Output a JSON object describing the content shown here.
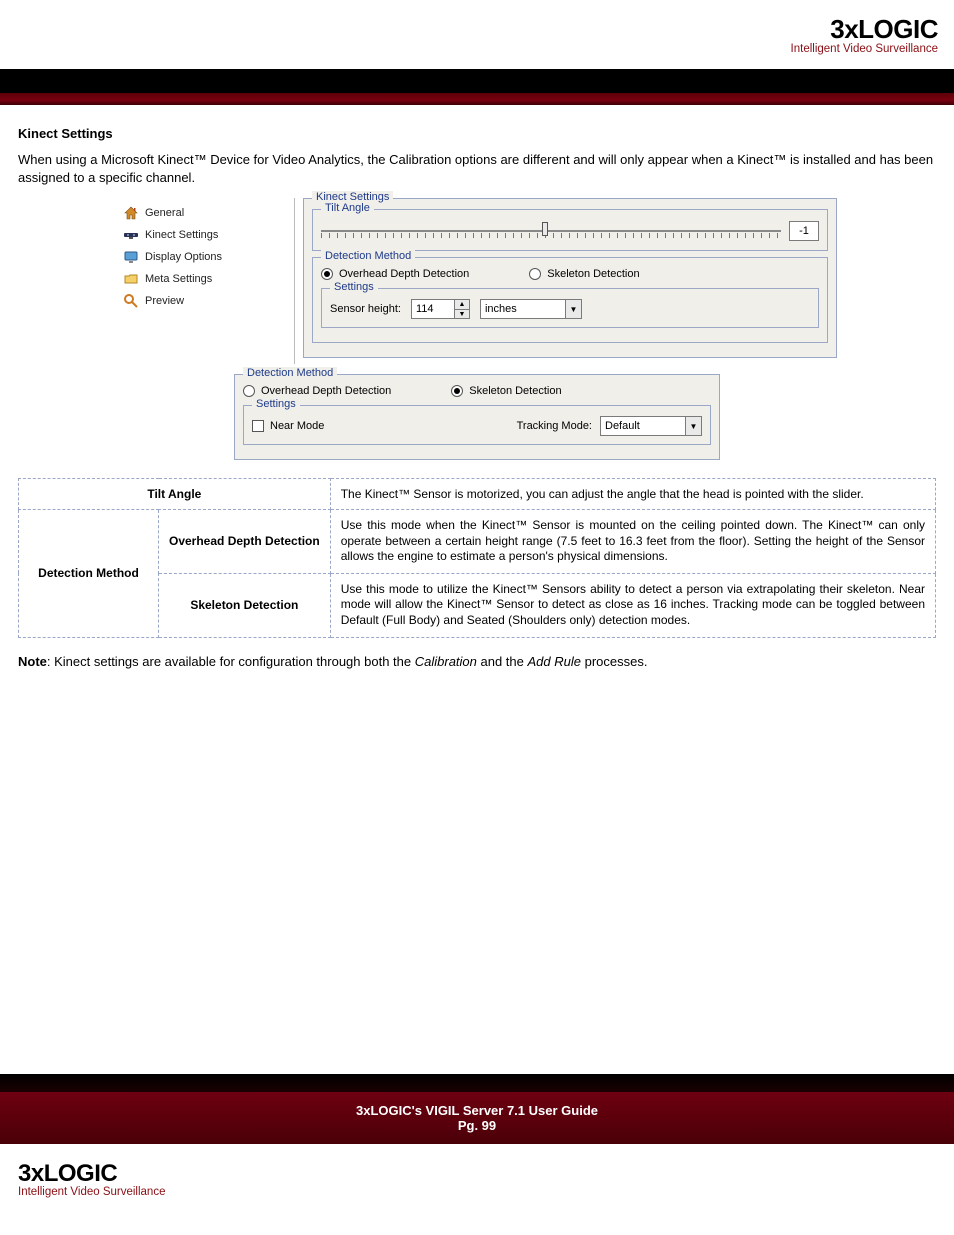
{
  "brand": {
    "text_prefix": "3",
    "text_x": "x",
    "text_suffix": "LOGIC",
    "tagline": "Intelligent Video Surveillance"
  },
  "section_title": "Kinect Settings",
  "intro_paragraph": "When using a Microsoft Kinect™ Device for Video Analytics, the Calibration options are different and will only appear when a Kinect™ is installed and has been assigned to a specific channel.",
  "shot1": {
    "tree": {
      "general": "General",
      "kinect": "Kinect Settings",
      "display": "Display Options",
      "meta": "Meta Settings",
      "preview": "Preview"
    },
    "kinect_group_title": "Kinect Settings",
    "tilt_group_title": "Tilt Angle",
    "tilt_value": "-1",
    "detection_group_title": "Detection Method",
    "opt_overhead": "Overhead Depth Detection",
    "opt_skeleton": "Skeleton Detection",
    "settings_group_title": "Settings",
    "sensor_height_label": "Sensor height:",
    "sensor_height_value": "114",
    "units_value": "inches"
  },
  "shot2": {
    "detection_group_title": "Detection Method",
    "opt_overhead": "Overhead Depth Detection",
    "opt_skeleton": "Skeleton Detection",
    "settings_group_title": "Settings",
    "near_mode_label": "Near Mode",
    "tracking_mode_label": "Tracking Mode:",
    "tracking_mode_value": "Default"
  },
  "table": {
    "r1c1": "Tilt Angle",
    "r1c2": "The Kinect™ Sensor is motorized, you can adjust the angle that the head is pointed with the slider.",
    "r2c1": "Detection Method",
    "r2a": "Overhead Depth Detection",
    "r2a_desc": "Use this mode when the Kinect™ Sensor is mounted on the ceiling pointed down.  The Kinect™ can only operate between a certain height range (7.5 feet to 16.3 feet from the floor).  Setting the height of the Sensor allows the engine to estimate a person's physical dimensions.",
    "r2b": "Skeleton Detection",
    "r2b_desc": "Use this mode to utilize the Kinect™ Sensors ability to detect a person via extrapolating their skeleton.  Near mode will allow the Kinect™ Sensor to detect as close as 16 inches.  Tracking mode can be toggled between Default (Full Body) and Seated (Shoulders only) detection modes."
  },
  "note_label": "Note",
  "note_text_1": ": Kinect settings are available for configuration through both the ",
  "note_em_1": "Calibration",
  "note_text_2": " and the ",
  "note_em_2": "Add Rule",
  "note_text_3": " processes.",
  "footer_title": "3xLOGIC's VIGIL Server 7.1 User Guide",
  "footer_page": "Pg. 99"
}
